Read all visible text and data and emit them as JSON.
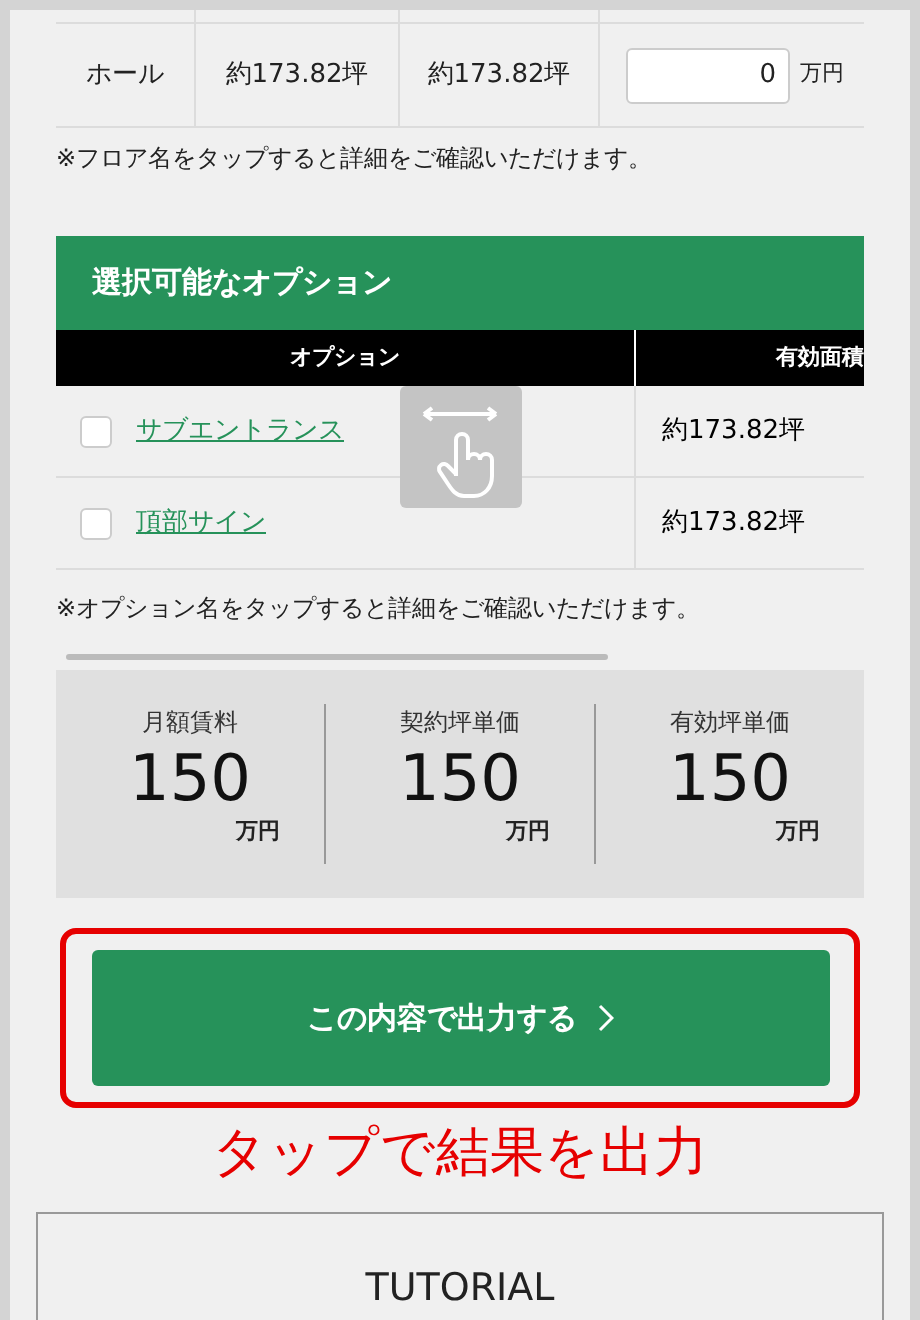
{
  "floor_table": {
    "rows": [
      {
        "name": "ホール",
        "contract_area": "約173.82坪",
        "effective_area": "約173.82坪",
        "price": "0",
        "unit": "万円"
      }
    ]
  },
  "floor_note": "※フロア名をタップすると詳細をご確認いただけます。",
  "options": {
    "title": "選択可能なオプション",
    "columns": [
      "オプション",
      "有効面積"
    ],
    "items": [
      {
        "name": "サブエントランス",
        "area": "約173.82坪",
        "checked": false
      },
      {
        "name": "頂部サイン",
        "area": "約173.82坪",
        "checked": false
      }
    ],
    "note": "※オプション名をタップすると詳細をご確認いただけます。"
  },
  "summary": [
    {
      "label": "月額賃料",
      "value": "150",
      "unit": "万円"
    },
    {
      "label": "契約坪単価",
      "value": "150",
      "unit": "万円"
    },
    {
      "label": "有効坪単価",
      "value": "150",
      "unit": "万円"
    }
  ],
  "output_button": {
    "label": "この内容で出力する"
  },
  "callout": "タップで結果を出力",
  "tutorial": {
    "title": "TUTORIAL"
  }
}
